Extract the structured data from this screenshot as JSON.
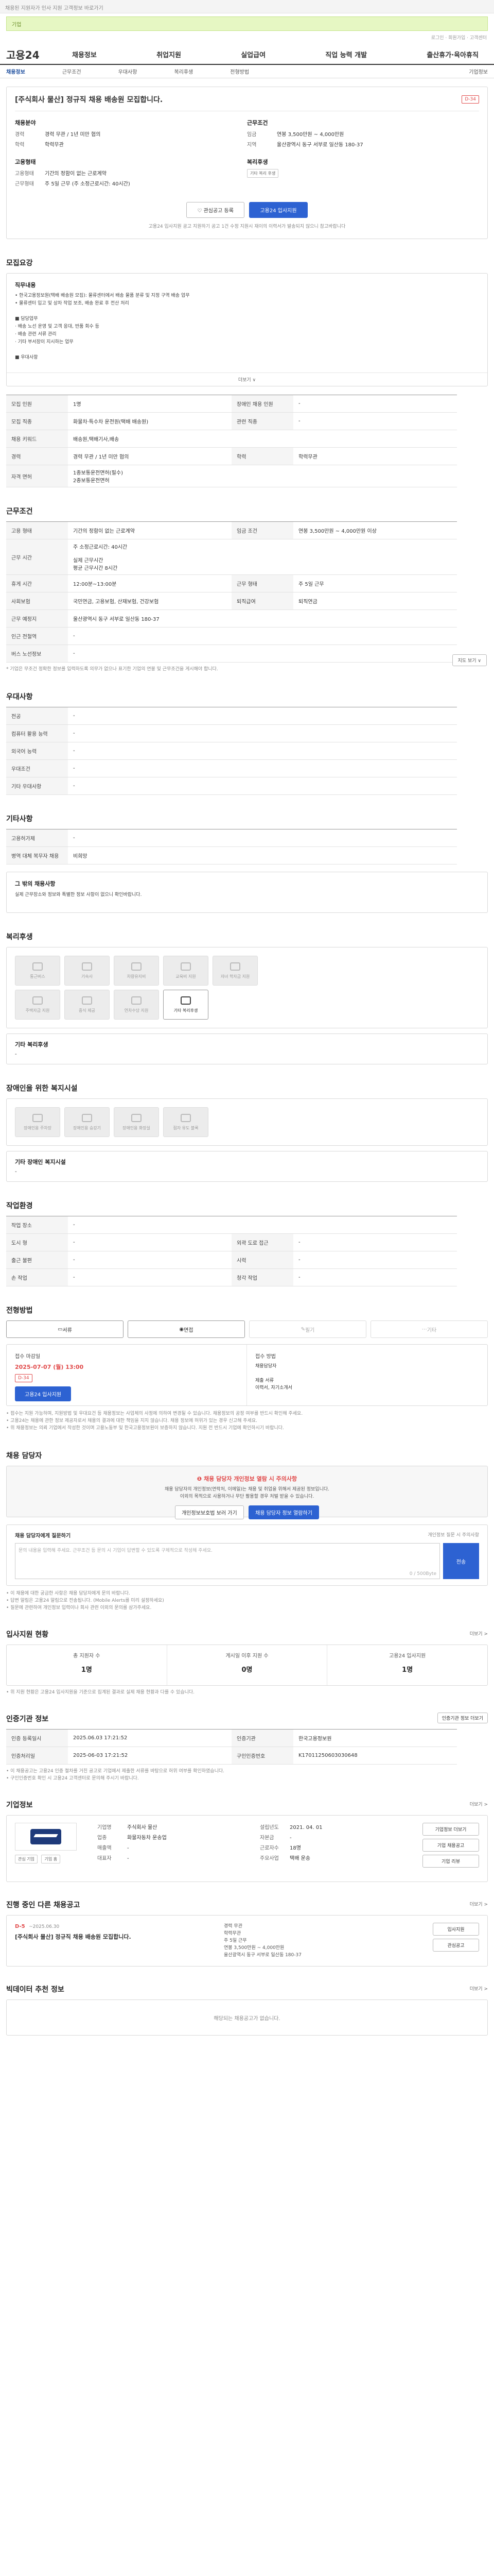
{
  "top": {
    "notice": "채용된 지원자가 인사 지원 고객정보 바로가기",
    "banner": "기업",
    "util": [
      "로그인",
      "회원가입",
      "고객센터"
    ]
  },
  "gnb": {
    "logo": "고용24",
    "menu": [
      "채용정보",
      "취업지원",
      "실업급여",
      "직업 능력 개발",
      "출산휴가·육아휴직"
    ]
  },
  "lnb": [
    "채용정보",
    "근무조건",
    "우대사항",
    "복리후생",
    "전형방법",
    "기업정보"
  ],
  "header": {
    "title": "[주식회사 물산] 정규직 채용 배송원 모집합니다.",
    "dday": "D-34",
    "left": {
      "title": "채용분야",
      "rows": [
        {
          "k": "경력",
          "v": "경력 무관 / 1년 미만 협의"
        },
        {
          "k": "학력",
          "v": "학력무관"
        }
      ]
    },
    "right": {
      "title": "근무조건",
      "rows": [
        {
          "k": "임금",
          "v": "연봉 3,500만원 ~ 4,000만원"
        },
        {
          "k": "지역",
          "v": "울산광역시 동구 서부로 일산동 180-37"
        }
      ]
    },
    "left2": {
      "title": "고용형태",
      "rows": [
        {
          "k": "고용형태",
          "v": "기간의 정함이 없는 근로계약"
        },
        {
          "k": "근무형태",
          "v": "주 5일 근무 (주 소정근로시간: 40시간)"
        }
      ]
    },
    "right2": {
      "title": "복리후생",
      "tag": "기타 복리 후생"
    },
    "btn_scrap": "관심공고 등록",
    "btn_apply": "고용24 입사지원",
    "apply_note": "고용24 입사지원 공고 지원하기 공고 1건 수정  지원시 재이의 이력서가 발송되지 않으니 참고바랍니다"
  },
  "recruit": {
    "heading": "모집요강",
    "desc_title": "직무내용",
    "desc": [
      "• 한국고용정보원(택배 배송원 모집): 물류센터에서 배송 물품 분류 및 지정 구역 배송 업무",
      "• 물류센터 입고 및 상차 작업 보조, 배송 완료 후 전산 처리",
      "",
      "■ 담당업무",
      " · 배송 노선 운영 및 고객 응대, 반품 회수 등",
      " · 배송 관련 서류 관리",
      " · 기타 부서장이 지시하는 업무",
      "",
      "■ 우대사항"
    ],
    "more": "더보기 ∨",
    "table": [
      [
        {
          "k": "모집 인원",
          "v": "1명"
        },
        {
          "k": "장애인 채용 인원",
          "v": "-"
        }
      ],
      [
        {
          "k": "모집 직종",
          "v": "화물차·특수차 운전원(택배 배송원)"
        },
        {
          "k": "관련 직종",
          "v": "-"
        }
      ],
      [
        {
          "k": "채용 키워드",
          "v": "배송원,택배기사,배송"
        },
        {
          "k": "",
          "v": ""
        }
      ],
      [
        {
          "k": "경력",
          "v": "경력 무관 / 1년 미만 협의"
        },
        {
          "k": "학력",
          "v": "학력무관"
        }
      ],
      [
        {
          "k": "자격 면허",
          "v": "1종보통운전면허(필수)\n2종보통운전면허"
        },
        {
          "k": "",
          "v": ""
        }
      ]
    ]
  },
  "cond": {
    "heading": "근무조건",
    "rows": [
      [
        {
          "k": "고용 형태",
          "v": "기간의 정함이 없는 근로계약"
        },
        {
          "k": "임금 조건",
          "v": "연봉 3,500만원 ~ 4,000만원 이상"
        }
      ],
      [
        {
          "k": "근무 시간",
          "v": "주 소정근로시간: 40시간\n\n실제 근무시간\n평균 근무시간 8시간"
        },
        {
          "k": "",
          "v": ""
        }
      ],
      [
        {
          "k": "휴게 시간",
          "v": "12:00분~13:00분"
        },
        {
          "k": "근무 형태",
          "v": "주 5일 근무"
        }
      ],
      [
        {
          "k": "사회보험",
          "v": "국민연금, 고용보험, 산재보험, 건강보험"
        },
        {
          "k": "퇴직급여",
          "v": "퇴직연금"
        }
      ],
      [
        {
          "k": "근무 예정지",
          "v": "울산광역시 동구 서부로 일산동 180-37"
        },
        {
          "k": "",
          "v": ""
        }
      ],
      [
        {
          "k": "인근 전철역",
          "v": "-"
        },
        {
          "k": "",
          "v": ""
        }
      ],
      [
        {
          "k": "버스 노선정보",
          "v": "-"
        },
        {
          "k": "",
          "v": ""
        }
      ]
    ],
    "map_btn": "지도 보기 ∨",
    "note": "* 기업은 무조건 정확한 정보를 입력하도록 의무가 없으나 표기한 기업의 연봉 및 근무조건을 게시해야 합니다."
  },
  "pref": {
    "heading": "우대사항",
    "rows": [
      {
        "k": "전공",
        "v": "-"
      },
      {
        "k": "컴퓨터 활용 능력",
        "v": "-"
      },
      {
        "k": "외국어 능력",
        "v": "-"
      },
      {
        "k": "우대조건",
        "v": "-"
      },
      {
        "k": "기타 우대사항",
        "v": "-"
      }
    ]
  },
  "etc": {
    "heading": "기타사항",
    "rows": [
      {
        "k": "고용허가제",
        "v": "-"
      },
      {
        "k": "병역 대체 복무자 채용",
        "v": "비희망"
      }
    ],
    "extra_title": "그 밖의 채용사항",
    "extra": "실제 근무장소와 정보와 특별한 정보 사항이 없으니 확인바랍니다."
  },
  "welfare": {
    "heading": "복리후생",
    "items": [
      "통근버스",
      "기숙사",
      "차량유지비",
      "교육비 지원",
      "자녀 학자금 지원",
      "주택자금 지원",
      "중식 제공",
      "연차수당 지원",
      "기타 복리후생"
    ],
    "etc_title": "기타 복리후생",
    "etc_val": "-"
  },
  "disabled": {
    "heading": "장애인을 위한 복지시설",
    "items": [
      "장애인용 주차장",
      "장애인용 승강기",
      "장애인용 화장실",
      "점자 유도 블록"
    ],
    "etc_title": "기타 장애인 복지시설",
    "etc_val": "-"
  },
  "office": {
    "heading": "작업환경",
    "rows": [
      [
        {
          "k": "작업 장소",
          "v": "-"
        },
        {
          "k": "",
          "v": ""
        }
      ],
      [
        {
          "k": "도시 형",
          "v": "-"
        },
        {
          "k": "외곽 도로 접근",
          "v": "-"
        }
      ],
      [
        {
          "k": "출근 불편",
          "v": "-"
        },
        {
          "k": "시력",
          "v": "-"
        }
      ],
      [
        {
          "k": "손 작업",
          "v": "-"
        },
        {
          "k": "청각 작업",
          "v": "-"
        }
      ]
    ]
  },
  "process": {
    "heading": "전형방법",
    "steps": [
      "서류",
      "면접",
      "필기",
      "기타"
    ],
    "left_title": "접수 마감일",
    "deadline": "2025-07-07 (월) 13:00",
    "dday": "D-34",
    "apply_btn": "고용24 입사지원",
    "method_title": "접수 방법",
    "method": "채용담당자\n\n제출 서류\n이력서, 자기소개서",
    "notes": [
      "• 접수는 지원 가능하며, 지원방법 및 우대요건 등 채용정보는 사업체의 사정에 의하여 변경될 수 있습니다. 채용정보의 공정 여부를 반드시 확인해 주세요.",
      "• 고용24는 채용에 관한 정보 제공자로서 채용의 결과에 대한 책임을 지지 않습니다. 채용 정보에 허위가 있는 경우 신고해 주세요.",
      "• 위 채용정보는 의뢰 기업에서 작성한 것이며 고용노동부 및 한국고용정보원이 보증하지 않습니다. 지원 전 반드시 기업에 확인하시기 바랍니다."
    ]
  },
  "contact": {
    "heading": "채용 담당자",
    "warn_title": "❶ 채용 담당자 개인정보 열람 시 주의사항",
    "warn_desc": "채용 담당자의 개인정보(연락처, 이메일)는 채용 및 취업을 위해서 제공된 정보입니다.\n이외의 목적으로 사용하거나 무단 활용할 경우 처벌 받을 수 있습니다.",
    "btn_policy": "개인정보보호법 보러 가기",
    "btn_view": "채용 담당자 정보 열람하기",
    "inquiry_label": "채용 담당자에게 질문하기",
    "inquiry_hint": "개인정보 질문 시 주의사항",
    "placeholder": "문의 내용을 입력해 주세요. 근무조건 등 문의 시 기업이 답변할 수 있도록 구체적으로 작성해 주세요.",
    "count": "0 / 500Byte",
    "send": "전송",
    "notes": [
      "• 이 채용에 대한 궁금한 사항은 채용 담당자에게 문의 바랍니다.",
      "• 답변 알림은 고용24 알림으로 전송됩니다. (Mobile Alerts를 미리 설정하세요)",
      "• 질문에 관련하여 개인정보 입력이나 회사 관련 이외의 문의를 삼가주세요."
    ]
  },
  "apply_stat": {
    "heading": "입사지원 현황",
    "more": "더보기 >",
    "items": [
      {
        "label": "총 지원자 수",
        "val": "1명"
      },
      {
        "label": "게시일 이후 지원 수",
        "val": "0명"
      },
      {
        "label": "고용24 입사지원",
        "val": "1명"
      }
    ],
    "note": "• 위 지원 현황은 고용24 입사지원을 기준으로 집계된 결과로 실제 채용 현황과 다를 수 있습니다."
  },
  "manage": {
    "heading": "인증기관 정보",
    "btn": "인증기관 정보 더보기",
    "rows": [
      [
        {
          "k": "인증 등록일시",
          "v": "2025.06.03 17:21:52"
        },
        {
          "k": "인증기관",
          "v": "한국고용정보원"
        }
      ],
      [
        {
          "k": "인증처리일",
          "v": "2025-06-03 17:21:52"
        },
        {
          "k": "구인인증번호",
          "v": "K17011250603030648"
        }
      ]
    ],
    "notes": [
      "• 이 채용공고는 고용24 인증 절차를 거친 공고로 기업에서 제출한 서류를 바탕으로 허위 여부를 확인하였습니다.",
      "• 구인인증번호 확인 시 고용24 고객센터로 문의해 주시기 바랍니다."
    ]
  },
  "company": {
    "heading": "기업정보",
    "more": "더보기 >",
    "name": "주식회사 물산",
    "tags": [
      "관심 기업",
      "기업 홈"
    ],
    "info": [
      [
        {
          "k": "기업명",
          "v": "주식회사 물산"
        },
        {
          "k": "설립년도",
          "v": "2021. 04. 01"
        }
      ],
      [
        {
          "k": "업종",
          "v": "화물자동차 운송업"
        },
        {
          "k": "자본금",
          "v": "-"
        }
      ],
      [
        {
          "k": "매출액",
          "v": "-"
        },
        {
          "k": "근로자수",
          "v": "18명"
        }
      ],
      [
        {
          "k": "대표자",
          "v": "-"
        },
        {
          "k": "주요사업",
          "v": "택배 운송"
        }
      ]
    ],
    "btns": [
      "기업정보 더보기",
      "기업 채용공고",
      "기업 리뷰"
    ]
  },
  "more_jobs": {
    "heading": "진행 중인 다른 채용공고",
    "more": "더보기 >",
    "dday": "D-5",
    "date": "~2025.06.30",
    "title": "[주식회사 물산] 정규직 채용 배송원 모집합니다.",
    "info": [
      "경력 무관",
      "학력무관",
      "주 5일 근무",
      "연봉 3,500만원 ~ 4,000만원",
      "울산광역시 동구 서부로 일산동 180-37"
    ],
    "btn_apply": "입사지원",
    "btn_scrap": "관심공고"
  },
  "review": {
    "heading": "빅데이터 추천 정보",
    "more": "더보기 >",
    "empty": "해당되는 채용공고가 없습니다."
  }
}
